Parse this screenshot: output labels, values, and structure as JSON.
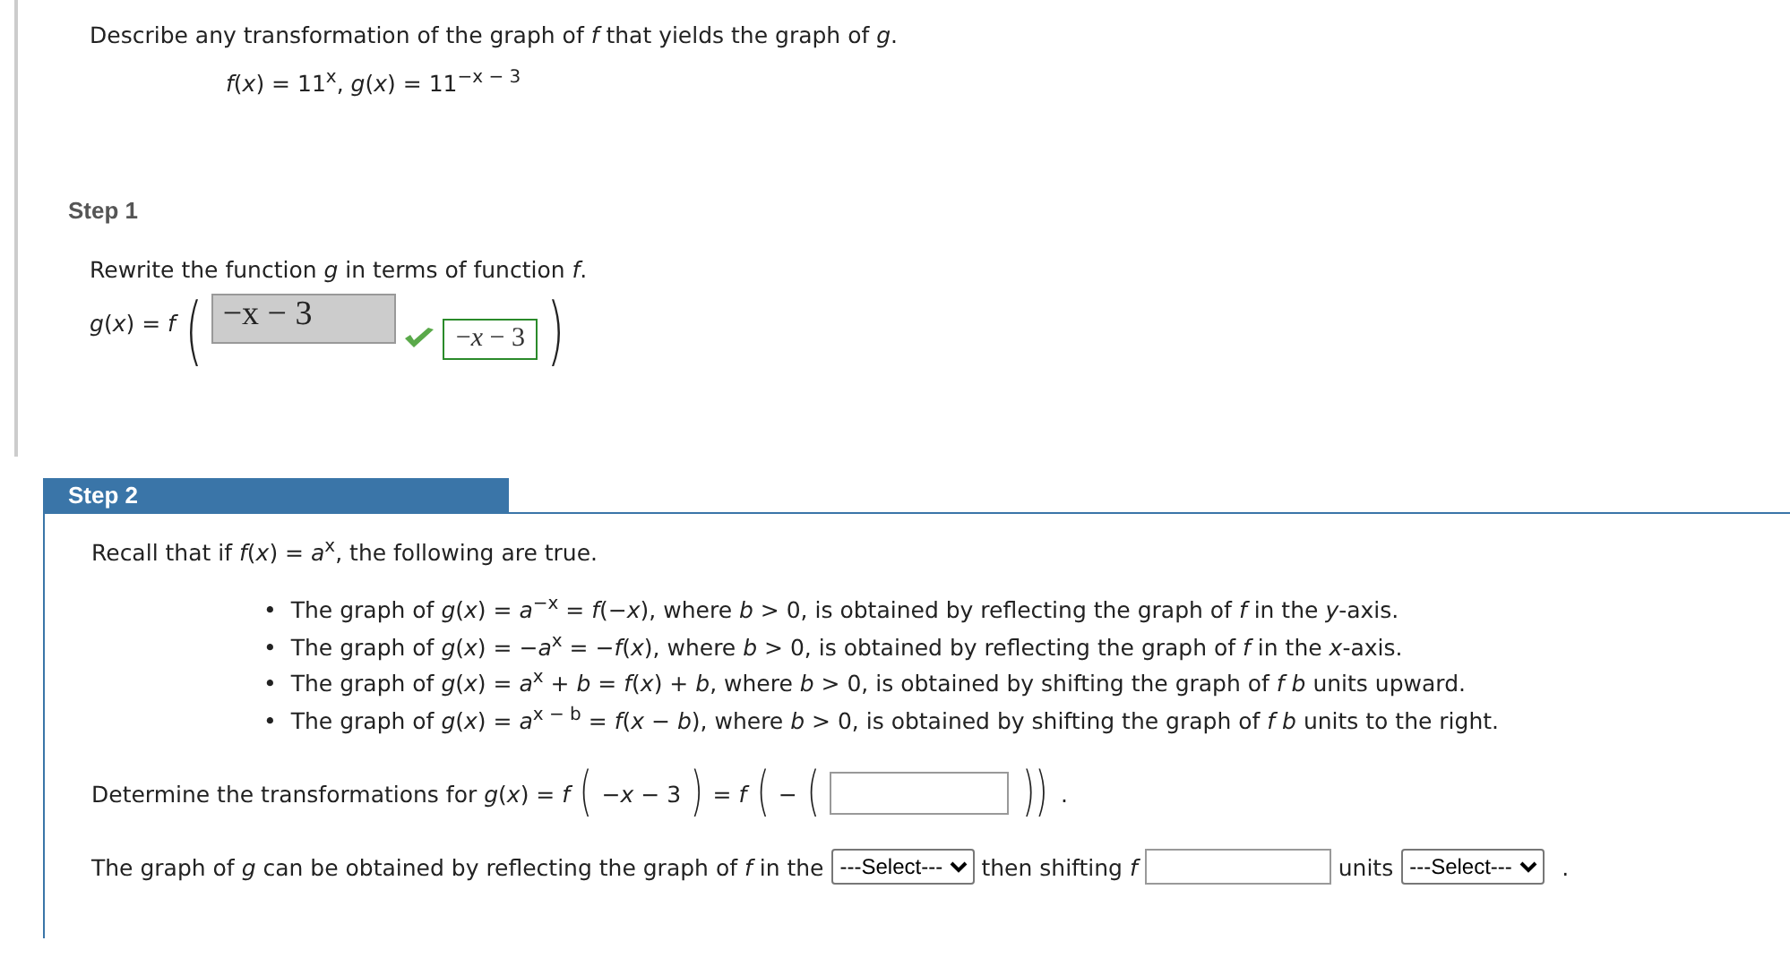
{
  "problem": {
    "prompt": "Describe any transformation of the graph of *f* that yields the graph of *g*.",
    "equation": "*f*(*x*) = 11$^{x}$,  *g*(*x*) = 11$^{−x − 3}$"
  },
  "step1": {
    "label": "Step 1",
    "selected": false,
    "instruction": "Rewrite the function *g* in terms of function *f*.",
    "lhs": "*g*(*x*) = *f*",
    "open": "(",
    "close": ")",
    "answer": {
      "value": "−x − 3",
      "correct": true,
      "preview": "−*x* − 3"
    }
  },
  "step2": {
    "label": "Step 2",
    "selected": true,
    "intro": "Recall that if *f*(*x*) = *a*$^{x}$, the following are true.",
    "bullets": [
      {
        "marker": "•",
        "text": "The graph of *g*(*x*) = *a*$^{−x}$ = *f*(−*x*), where *b* > 0, is obtained by reflecting the graph of *f* in the *y*-axis."
      },
      {
        "marker": "•",
        "text": "The graph of *g*(*x*) = −*a*$^{x}$ = −*f*(*x*), where *b* > 0, is obtained by reflecting the graph of *f* in the *x*-axis."
      },
      {
        "marker": "•",
        "text": "The graph of *g*(*x*) = *a*$^{x}$ + *b* = *f*(*x*) + *b*, where *b* > 0, is obtained by shifting the graph of *f* *b* units upward."
      },
      {
        "marker": "•",
        "text": "The graph of *g*(*x*) = *a*$^{x − b}$ = *f*(*x* − *b*), where *b* > 0, is obtained by shifting the graph of *f* *b* units to the right."
      }
    ],
    "determine": {
      "prefix": "Determine the transformations for *g*(*x*) = *f*",
      "open": "(",
      "inner": "−*x* − 3",
      "close": ")",
      "mid": "= *f*",
      "open2": "(",
      "minus": "−",
      "open3": "(",
      "close2": "))",
      "end": "."
    },
    "final": {
      "prefix": "The graph of *g* can be obtained by reflecting the graph of *f* in the",
      "select1": "---Select---",
      "middle": "then shifting *f*",
      "units": "units",
      "select2": "---Select---",
      "end": "."
    }
  }
}
